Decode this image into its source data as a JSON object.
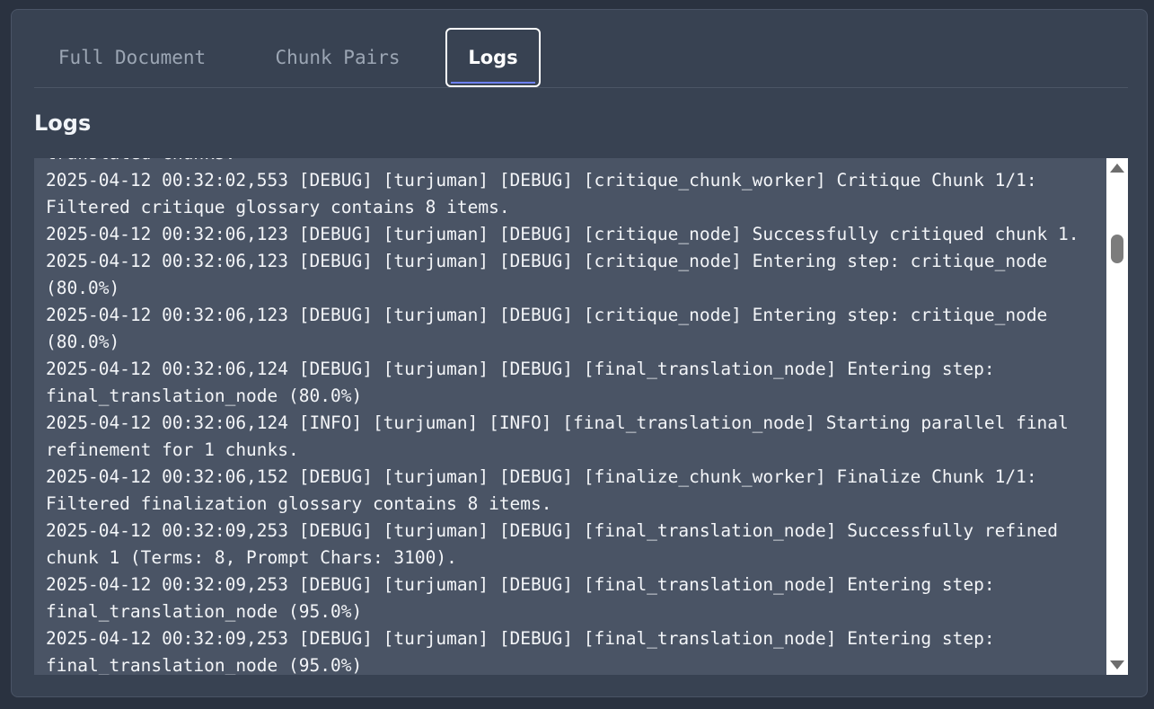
{
  "tabs": [
    {
      "label": "Full Document"
    },
    {
      "label": "Chunk Pairs"
    },
    {
      "label": "Logs"
    }
  ],
  "active_tab": "Logs",
  "section_title": "Logs",
  "log_lines": [
    "translated chunks.",
    "2025-04-12 00:32:02,553 [DEBUG] [turjuman] [DEBUG] [critique_chunk_worker] Critique Chunk 1/1:",
    "Filtered critique glossary contains 8 items.",
    "2025-04-12 00:32:06,123 [DEBUG] [turjuman] [DEBUG] [critique_node] Successfully critiqued chunk 1.",
    "2025-04-12 00:32:06,123 [DEBUG] [turjuman] [DEBUG] [critique_node] Entering step: critique_node",
    "(80.0%)",
    "2025-04-12 00:32:06,123 [DEBUG] [turjuman] [DEBUG] [critique_node] Entering step: critique_node",
    "(80.0%)",
    "2025-04-12 00:32:06,124 [DEBUG] [turjuman] [DEBUG] [final_translation_node] Entering step:",
    "final_translation_node (80.0%)",
    "2025-04-12 00:32:06,124 [INFO] [turjuman] [INFO] [final_translation_node] Starting parallel final",
    "refinement for 1 chunks.",
    "2025-04-12 00:32:06,152 [DEBUG] [turjuman] [DEBUG] [finalize_chunk_worker] Finalize Chunk 1/1:",
    "Filtered finalization glossary contains 8 items.",
    "2025-04-12 00:32:09,253 [DEBUG] [turjuman] [DEBUG] [final_translation_node] Successfully refined",
    "chunk 1 (Terms: 8, Prompt Chars: 3100).",
    "2025-04-12 00:32:09,253 [DEBUG] [turjuman] [DEBUG] [final_translation_node] Entering step:",
    "final_translation_node (95.0%)",
    "2025-04-12 00:32:09,253 [DEBUG] [turjuman] [DEBUG] [final_translation_node] Entering step:",
    "final_translation_node (95.0%)"
  ],
  "colors": {
    "background": "#2a3240",
    "panel": "#384252",
    "log_box": "#4a5465",
    "active_tab_underline": "#6d7ff0",
    "text": "#f3f5f8",
    "inactive_tab_text": "#9ca6b4"
  },
  "icons": {
    "scroll_up": "scroll-up-arrow-icon",
    "scroll_down": "scroll-down-arrow-icon"
  }
}
